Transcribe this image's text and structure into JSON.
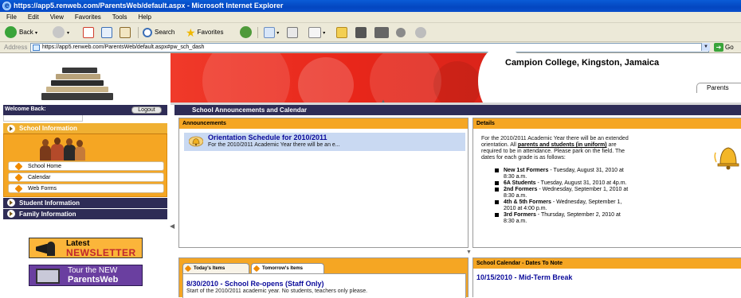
{
  "browser": {
    "title": "https://app5.renweb.com/ParentsWeb/default.aspx - Microsoft Internet Explorer",
    "menu": [
      "File",
      "Edit",
      "View",
      "Favorites",
      "Tools",
      "Help"
    ],
    "toolbar": {
      "back": "Back",
      "search": "Search",
      "favorites": "Favorites"
    },
    "address_label": "Address",
    "address_url": "https://app5.renweb.com/ParentsWeb/default.aspx#pw_sch_dash",
    "go_label": "Go"
  },
  "header": {
    "school_name": "Campion College, Kingston, Jamaica",
    "tab_label": "Parents"
  },
  "sidebar": {
    "welcome": "Welcome Back:",
    "logout": "Logout",
    "school_info": {
      "title": "School Information",
      "links": [
        "School Home",
        "Calendar",
        "Web Forms"
      ]
    },
    "student_info": "Student Information",
    "family_info": "Family Information",
    "newsletter": {
      "line1": "Latest",
      "line2": "NEWSLETTER"
    },
    "tour": {
      "line1": "Tour the NEW",
      "line2": "ParentsWeb"
    }
  },
  "main": {
    "title": "School Announcements and Calendar",
    "announcements": {
      "heading": "Announcements",
      "item_title": "Orientation Schedule for 2010/2011",
      "item_snippet": "For the 2010/2011 Academic Year there will be an e..."
    },
    "details": {
      "heading": "Details",
      "intro_1": "For the 2010/2011 Academic Year there will be an extended",
      "intro_2a": "orientation. All ",
      "intro_2b": "parents and students (in uniform)",
      "intro_2c": " are",
      "intro_3": "required to be in attendance. Please park on the field. The",
      "intro_4": "dates for each grade is as follows:",
      "items": [
        {
          "label": "New 1st Formers",
          "text": " - Tuesday, August 31, 2010 at",
          "cont": "8:30 a.m."
        },
        {
          "label": "6A Students",
          "text": " - Tuesday, August 31, 2010 at 4p.m.",
          "cont": ""
        },
        {
          "label": "2nd Formers",
          "text": " - Wednesday, September 1, 2010 at",
          "cont": "8:30 a.m."
        },
        {
          "label": "4th & 5th Formers",
          "text": " - Wednesday, September 1,",
          "cont": "2010 at 4:00 p.m."
        },
        {
          "label": "3rd Formers",
          "text": " - Thursday, September 2, 2010 at",
          "cont": "8:30 a.m."
        }
      ]
    },
    "items_tabs": [
      "Today's Items",
      "Tomorrow's Items"
    ],
    "today_item": {
      "title": "8/30/2010 - School Re-opens (Staff Only)",
      "desc": "Start of the 2010/2011 academic year. No students, teachers only please."
    },
    "calendar": {
      "heading": "School Calendar - Dates To Note",
      "item": "10/15/2010 - Mid-Term Break"
    }
  },
  "colors": {
    "navy": "#2e2c56",
    "orange": "#f5a623",
    "link_blue": "#0a0a9a",
    "banner_red": "#e8261a"
  }
}
